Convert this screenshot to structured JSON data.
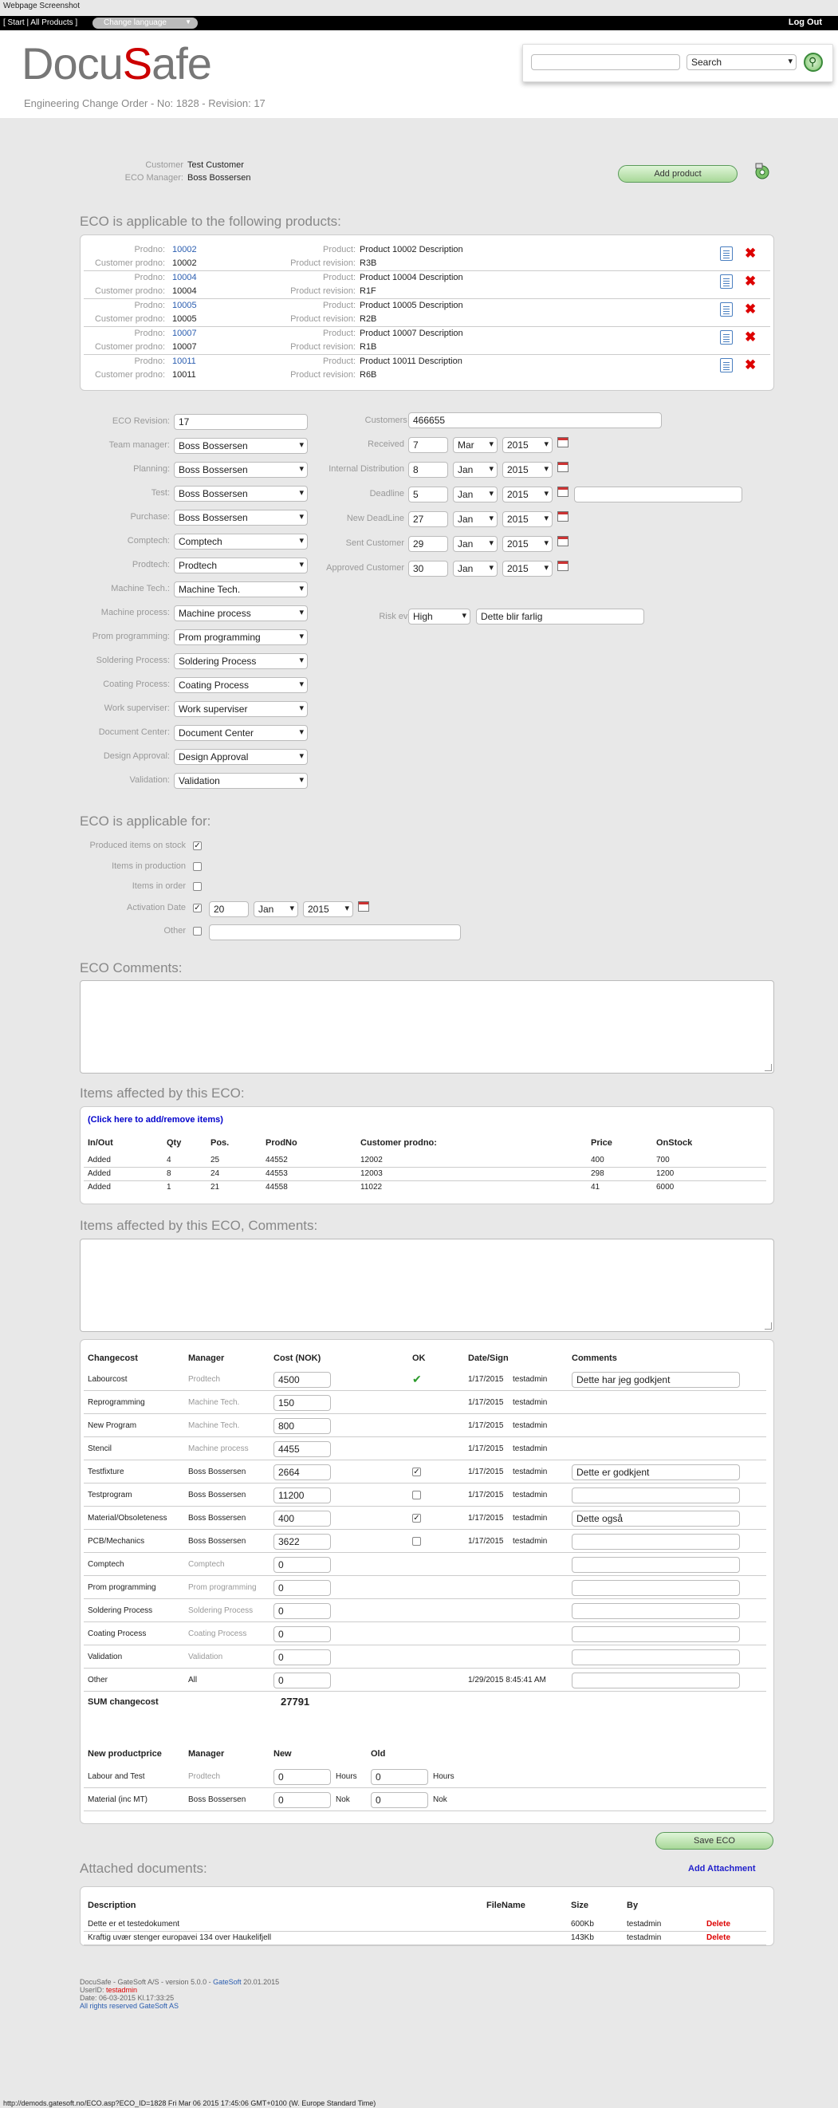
{
  "window": {
    "title": "Webpage Screenshot",
    "status_url": "http://demods.gatesoft.no/ECO.asp?ECO_ID=1828 Fri Mar 06 2015 17:45:06 GMT+0100 (W. Europe Standard Time)"
  },
  "topbar": {
    "links": "[ Start | All Products ]",
    "language": "Change language",
    "logout": "Log Out"
  },
  "header": {
    "logo_part1": "Docu",
    "logo_part2": "S",
    "logo_part3": "afe",
    "subtitle": "Engineering Change Order - No: 1828  -  Revision: 17",
    "search_value": "",
    "search_select": "Search"
  },
  "customer": {
    "customer_label": "Customer",
    "customer_value": "Test Customer",
    "manager_label": "ECO Manager:",
    "manager_value": "Boss Bossersen",
    "add_product": "Add product"
  },
  "products_section": {
    "title": "ECO is applicable to the following products:",
    "labels": {
      "prodno": "Prodno:",
      "customer_prodno": "Customer prodno:",
      "product": "Product:",
      "revision": "Product revision:"
    },
    "items": [
      {
        "prodno": "10002",
        "customer_prodno": "10002",
        "product": "Product 10002 Description",
        "revision": "R3B"
      },
      {
        "prodno": "10004",
        "customer_prodno": "10004",
        "product": "Product 10004 Description",
        "revision": "R1F"
      },
      {
        "prodno": "10005",
        "customer_prodno": "10005",
        "product": "Product 10005 Description",
        "revision": "R2B"
      },
      {
        "prodno": "10007",
        "customer_prodno": "10007",
        "product": "Product 10007 Description",
        "revision": "R1B"
      },
      {
        "prodno": "10011",
        "customer_prodno": "10011",
        "product": "Product 10011 Description",
        "revision": "R6B"
      }
    ]
  },
  "form": {
    "left": [
      {
        "label": "ECO Revision:",
        "value": "17",
        "type": "input"
      },
      {
        "label": "Team manager:",
        "value": "Boss Bossersen",
        "type": "select"
      },
      {
        "label": "Planning:",
        "value": "Boss Bossersen",
        "type": "select"
      },
      {
        "label": "Test:",
        "value": "Boss Bossersen",
        "type": "select"
      },
      {
        "label": "Purchase:",
        "value": "Boss Bossersen",
        "type": "select"
      },
      {
        "label": "Comptech:",
        "value": "Comptech",
        "type": "select"
      },
      {
        "label": "Prodtech:",
        "value": "Prodtech",
        "type": "select"
      },
      {
        "label": "Machine Tech.:",
        "value": "Machine Tech.",
        "type": "select"
      },
      {
        "label": "Machine process:",
        "value": "Machine process",
        "type": "select"
      },
      {
        "label": "Prom programming:",
        "value": "Prom programming",
        "type": "select"
      },
      {
        "label": "Soldering Process:",
        "value": "Soldering Process",
        "type": "select"
      },
      {
        "label": "Coating Process:",
        "value": "Coating Process",
        "type": "select"
      },
      {
        "label": "Work superviser:",
        "value": "Work superviser",
        "type": "select"
      },
      {
        "label": "Document Center:",
        "value": "Document Center",
        "type": "select"
      },
      {
        "label": "Design Approval:",
        "value": "Design Approval",
        "type": "select"
      },
      {
        "label": "Validation:",
        "value": "Validation",
        "type": "select"
      }
    ],
    "customers_econo_label": "Customers ECOno:",
    "customers_econo": "466655",
    "dates": [
      {
        "label": "Received",
        "day": "7",
        "month": "Mar",
        "year": "2015"
      },
      {
        "label": "Internal Distribution",
        "day": "8",
        "month": "Jan",
        "year": "2015"
      },
      {
        "label": "Deadline",
        "day": "5",
        "month": "Jan",
        "year": "2015"
      },
      {
        "label": "New DeadLine",
        "day": "27",
        "month": "Jan",
        "year": "2015"
      },
      {
        "label": "Sent Customer",
        "day": "29",
        "month": "Jan",
        "year": "2015"
      },
      {
        "label": "Approved Customer",
        "day": "30",
        "month": "Jan",
        "year": "2015"
      }
    ],
    "risk_label": "Risk evaluation:",
    "risk_value": "High",
    "risk_comment": "Dette blir farlig"
  },
  "applicable_for": {
    "title": "ECO is applicable for:",
    "items": [
      {
        "label": "Produced items on stock",
        "checked": "✓"
      },
      {
        "label": "Items in production",
        "checked": ""
      },
      {
        "label": "Items in order",
        "checked": ""
      },
      {
        "label": "Activation Date",
        "checked": "✓"
      },
      {
        "label": "Other",
        "checked": ""
      }
    ],
    "activation_day": "20",
    "activation_month": "Jan",
    "activation_year": "2015"
  },
  "comments": {
    "title": "ECO Comments:"
  },
  "items_affected": {
    "title": "Items affected by this ECO:",
    "link": "(Click here to add/remove items)",
    "headers": [
      "In/Out",
      "Qty",
      "Pos.",
      "ProdNo",
      "Customer prodno:",
      "Price",
      "OnStock"
    ],
    "rows": [
      [
        "Added",
        "4",
        "25",
        "44552",
        "12002",
        "400",
        "700"
      ],
      [
        "Added",
        "8",
        "24",
        "44553",
        "12003",
        "298",
        "1200"
      ],
      [
        "Added",
        "1",
        "21",
        "44558",
        "11022",
        "41",
        "6000"
      ]
    ]
  },
  "items_comments": {
    "title": "Items affected by this ECO, Comments:"
  },
  "changecost": {
    "headers": [
      "Changecost",
      "Manager",
      "Cost (NOK)",
      "OK",
      "Date/Sign",
      "Comments"
    ],
    "rows": [
      {
        "name": "Labourcost",
        "manager": "Prodtech",
        "cost": "4500",
        "ok": "✔",
        "date": "1/17/2015",
        "sign": "testadmin",
        "comment": "Dette har jeg godkjent"
      },
      {
        "name": "Reprogramming",
        "manager": "Machine Tech.",
        "cost": "150",
        "ok": "",
        "date": "1/17/2015",
        "sign": "testadmin",
        "comment": ""
      },
      {
        "name": "New Program",
        "manager": "Machine Tech.",
        "cost": "800",
        "ok": "",
        "date": "1/17/2015",
        "sign": "testadmin",
        "comment": ""
      },
      {
        "name": "Stencil",
        "manager": "Machine process",
        "cost": "4455",
        "ok": "",
        "date": "1/17/2015",
        "sign": "testadmin",
        "comment": ""
      },
      {
        "name": "Testfixture",
        "manager": "Boss Bossersen",
        "cost": "2664",
        "ok": "✓",
        "date": "1/17/2015",
        "sign": "testadmin",
        "comment": "Dette er godkjent"
      },
      {
        "name": "Testprogram",
        "manager": "Boss Bossersen",
        "cost": "11200",
        "ok": "",
        "date": "1/17/2015",
        "sign": "testadmin",
        "comment": ""
      },
      {
        "name": "Material/Obsoleteness",
        "manager": "Boss Bossersen",
        "cost": "400",
        "ok": "✓",
        "date": "1/17/2015",
        "sign": "testadmin",
        "comment": "Dette også"
      },
      {
        "name": "PCB/Mechanics",
        "manager": "Boss Bossersen",
        "cost": "3622",
        "ok": "",
        "date": "1/17/2015",
        "sign": "testadmin",
        "comment": ""
      },
      {
        "name": "Comptech",
        "manager": "Comptech",
        "cost": "0",
        "ok": "",
        "date": "",
        "sign": "",
        "comment": ""
      },
      {
        "name": "Prom programming",
        "manager": "Prom programming",
        "cost": "0",
        "ok": "",
        "date": "",
        "sign": "",
        "comment": ""
      },
      {
        "name": "Soldering Process",
        "manager": "Soldering Process",
        "cost": "0",
        "ok": "",
        "date": "",
        "sign": "",
        "comment": ""
      },
      {
        "name": "Coating Process",
        "manager": "Coating Process",
        "cost": "0",
        "ok": "",
        "date": "",
        "sign": "",
        "comment": ""
      },
      {
        "name": "Validation",
        "manager": "Validation",
        "cost": "0",
        "ok": "",
        "date": "",
        "sign": "",
        "comment": ""
      },
      {
        "name": "Other",
        "manager": "All",
        "cost": "0",
        "ok": "",
        "date": "1/29/2015 8:45:41 AM",
        "sign": "",
        "comment": ""
      }
    ],
    "sum_label": "SUM changecost",
    "sum_value": "27791"
  },
  "productprice": {
    "headers": [
      "New productprice",
      "Manager",
      "New",
      "Old"
    ],
    "rows": [
      {
        "name": "Labour and Test",
        "manager": "Prodtech",
        "new": "0",
        "new_unit": "Hours",
        "old": "0",
        "old_unit": "Hours"
      },
      {
        "name": "Material (inc MT)",
        "manager": "Boss Bossersen",
        "new": "0",
        "new_unit": "Nok",
        "old": "0",
        "old_unit": "Nok"
      }
    ]
  },
  "save": {
    "label": "Save ECO"
  },
  "attachments": {
    "title": "Attached documents:",
    "add": "Add Attachment",
    "headers": [
      "Description",
      "FileName",
      "Size",
      "By"
    ],
    "rows": [
      {
        "description": "Dette er et testedokument",
        "filename": "",
        "size": "600Kb",
        "by": "testadmin",
        "action": "Delete"
      },
      {
        "description": "Kraftig uvær stenger europavei 134 over Haukelifjell",
        "filename": "",
        "size": "143Kb",
        "by": "testadmin",
        "action": "Delete"
      }
    ]
  },
  "footer": {
    "line1a": "DocuSafe - GateSoft A/S - version 5.0.0 - ",
    "line1b": "GateSoft",
    "line1c": " 20.01.2015",
    "userid_label": "UserID: ",
    "userid": "testadmin",
    "date": "Date: 06-03-2015  Kl.17:33:25",
    "rights": "All rights reserved GateSoft AS"
  },
  "colors": {
    "accent_green": "#a8d898",
    "delete_red": "#dd0000",
    "link_blue": "#2a5db0",
    "background": "#e8e8e8"
  }
}
